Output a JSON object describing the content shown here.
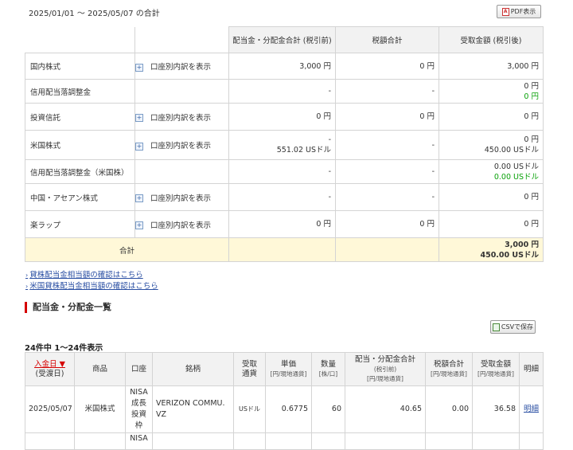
{
  "period_label": "2025/01/01 〜 2025/05/07 の合計",
  "pdf_button": "PDF表示",
  "summary": {
    "headers": [
      "配当金・分配金合計 (税引前)",
      "税額合計",
      "受取金額 (税引後)"
    ],
    "breakdown_label": "口座別内訳を表示",
    "rows": [
      {
        "name": "国内株式",
        "has_breakdown": true,
        "gross": [
          "3,000 円"
        ],
        "tax": [
          "0 円"
        ],
        "net": [
          "3,000 円"
        ],
        "net_green": []
      },
      {
        "name": "信用配当落調整金",
        "has_breakdown": false,
        "gross": [
          "-"
        ],
        "tax": [
          "-"
        ],
        "net": [
          "0 円"
        ],
        "net_green": [
          "0 円"
        ]
      },
      {
        "name": "投資信託",
        "has_breakdown": true,
        "gross": [
          "0 円"
        ],
        "tax": [
          "0 円"
        ],
        "net": [
          "0 円"
        ],
        "net_green": []
      },
      {
        "name": "米国株式",
        "has_breakdown": true,
        "gross": [
          "-",
          "551.02 USドル"
        ],
        "tax": [
          "-"
        ],
        "net": [
          "0 円",
          "450.00 USドル"
        ],
        "net_green": []
      },
      {
        "name": "信用配当落調整金（米国株）",
        "has_breakdown": false,
        "gross": [
          "-"
        ],
        "tax": [
          "-"
        ],
        "net": [
          "0.00 USドル"
        ],
        "net_green": [
          "0.00 USドル"
        ]
      },
      {
        "name": "中国・アセアン株式",
        "has_breakdown": true,
        "gross": [
          "-"
        ],
        "tax": [
          "-"
        ],
        "net": [
          "0 円"
        ],
        "net_green": []
      },
      {
        "name": "楽ラップ",
        "has_breakdown": true,
        "gross": [
          "0 円"
        ],
        "tax": [
          "0 円"
        ],
        "net": [
          "0 円"
        ],
        "net_green": []
      }
    ],
    "total": {
      "label": "合計",
      "net": [
        "3,000 円",
        "450.00 USドル"
      ]
    }
  },
  "links": [
    "貸株配当金相当額の確認はこちら",
    "米国貸株配当金相当額の確認はこちら"
  ],
  "section_title": "配当金・分配金一覧",
  "csv_button": "CSVで保存",
  "result_count": "24件中 1〜24件表示",
  "detail": {
    "headers": {
      "date": "入金日 ▼",
      "date_sub": "(受渡日)",
      "product": "商品",
      "account": "口座",
      "issue": "銘柄",
      "currency": "受取\n通貨",
      "unit_price": "単価",
      "unit_price_sub": "[円/現地通貨]",
      "quantity": "数量",
      "quantity_sub": "[株/口]",
      "gross": "配当・分配金合計",
      "gross_mid": "(税引前)",
      "gross_sub": "[円/現地通貨]",
      "tax": "税額合計",
      "tax_sub": "[円/現地通貨]",
      "net": "受取金額",
      "net_sub": "[円/現地通貨]",
      "statement": "明細"
    },
    "rows": [
      {
        "date": "2025/05/07",
        "product": "米国株式",
        "account": "NISA\n成長\n投資\n枠",
        "issue": "VERIZON COMMU.\nVZ",
        "currency": "USドル",
        "unit_price": "0.6775",
        "quantity": "60",
        "gross": "40.65",
        "tax": "0.00",
        "net": "36.58",
        "statement": "明細"
      },
      {
        "date": "",
        "product": "",
        "account": "NISA",
        "issue": "",
        "currency": "",
        "unit_price": "",
        "quantity": "",
        "gross": "",
        "tax": "",
        "net": "",
        "statement": ""
      }
    ]
  }
}
